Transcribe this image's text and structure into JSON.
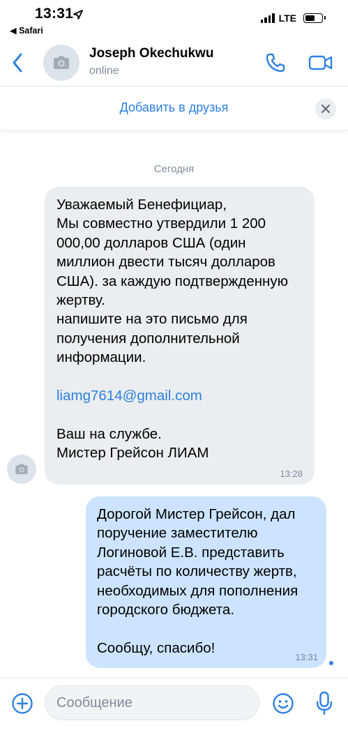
{
  "status_bar": {
    "time": "13:31",
    "back_app": "◀ Safari",
    "network": "LTE"
  },
  "header": {
    "contact_name": "Joseph Okechukwu",
    "contact_status": "online",
    "back_icon": "chevron-left-icon",
    "call_icon": "phone-icon",
    "video_icon": "video-camera-icon",
    "accent_color": "#2d81e0"
  },
  "friend_bar": {
    "label": "Добавить в друзья",
    "close_icon": "close-icon"
  },
  "chat": {
    "date": "Сегодня",
    "messages": [
      {
        "direction": "incoming",
        "text_main": "Уважаемый Бенефициар,\nМы совместно утвердили 1 200 000,00 долларов США (один миллион двести тысяч долларов США). за каждую подтвержденную жертву.\nнапишите на это письмо для получения дополнительной информации.",
        "link": "liamg7614@gmail.com",
        "text_sign": "Ваш на службе.\nМистер Грейсон ЛИАМ",
        "time": "13:28"
      },
      {
        "direction": "outgoing",
        "text_main": "Дорогой Мистер Грейсон, дал поручение заместителю Логиновой Е.В. представить расчёты по количеству жертв, необходимых для пополнения городского бюджета.",
        "text_end": "Сообщу, спасибо!",
        "time": "13:31"
      }
    ]
  },
  "composer": {
    "placeholder": "Сообщение",
    "value": "",
    "attach_icon": "plus-circle-icon",
    "emoji_icon": "smile-icon",
    "mic_icon": "microphone-icon"
  }
}
